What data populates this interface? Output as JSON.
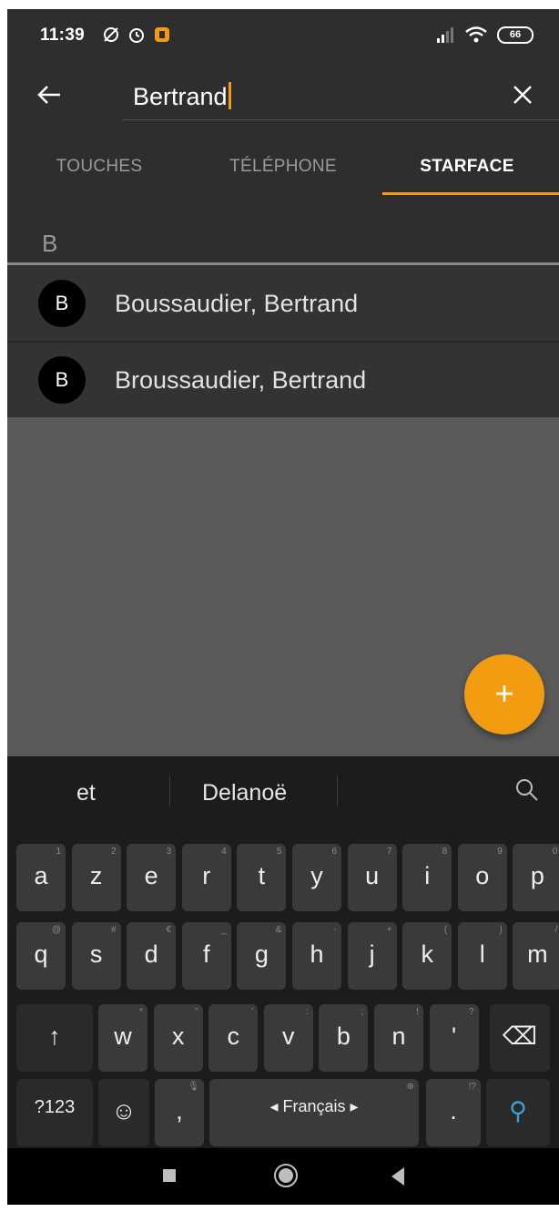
{
  "status": {
    "time": "11:39",
    "battery": "66"
  },
  "search": {
    "query": "Bertrand"
  },
  "tabs": [
    {
      "label": "TOUCHES"
    },
    {
      "label": "TÉLÉPHONE"
    },
    {
      "label": "STARFACE"
    }
  ],
  "section": {
    "letter": "B"
  },
  "results": [
    {
      "initial": "B",
      "name": "Boussaudier, Bertrand"
    },
    {
      "initial": "B",
      "name": "Broussaudier, Bertrand"
    }
  ],
  "fab": {
    "label": "+"
  },
  "keyboard": {
    "suggestions": [
      "et",
      "Delanoë"
    ],
    "row1": [
      {
        "k": "a",
        "h": "1"
      },
      {
        "k": "z",
        "h": "2"
      },
      {
        "k": "e",
        "h": "3"
      },
      {
        "k": "r",
        "h": "4"
      },
      {
        "k": "t",
        "h": "5"
      },
      {
        "k": "y",
        "h": "6"
      },
      {
        "k": "u",
        "h": "7"
      },
      {
        "k": "i",
        "h": "8"
      },
      {
        "k": "o",
        "h": "9"
      },
      {
        "k": "p",
        "h": "0"
      }
    ],
    "row2": [
      {
        "k": "q",
        "h": "@"
      },
      {
        "k": "s",
        "h": "#"
      },
      {
        "k": "d",
        "h": "€"
      },
      {
        "k": "f",
        "h": "_"
      },
      {
        "k": "g",
        "h": "&"
      },
      {
        "k": "h",
        "h": "-"
      },
      {
        "k": "j",
        "h": "+"
      },
      {
        "k": "k",
        "h": "("
      },
      {
        "k": "l",
        "h": ")"
      },
      {
        "k": "m",
        "h": "/"
      }
    ],
    "row3": [
      {
        "k": "w",
        "h": "*"
      },
      {
        "k": "x",
        "h": "\""
      },
      {
        "k": "c",
        "h": "'"
      },
      {
        "k": "v",
        "h": ":"
      },
      {
        "k": "b",
        "h": ";"
      },
      {
        "k": "n",
        "h": "!"
      },
      {
        "k": "'",
        "h": "?"
      }
    ],
    "shift": "↑",
    "backspace": "⌫",
    "symbols": "?123",
    "emoji": "☺",
    "comma": ",",
    "space": "◂ Français ▸",
    "period": ".",
    "period_hint": "!?",
    "search": "⚲"
  },
  "navbar": {
    "recents": "■",
    "home": "●",
    "back": "◀"
  }
}
